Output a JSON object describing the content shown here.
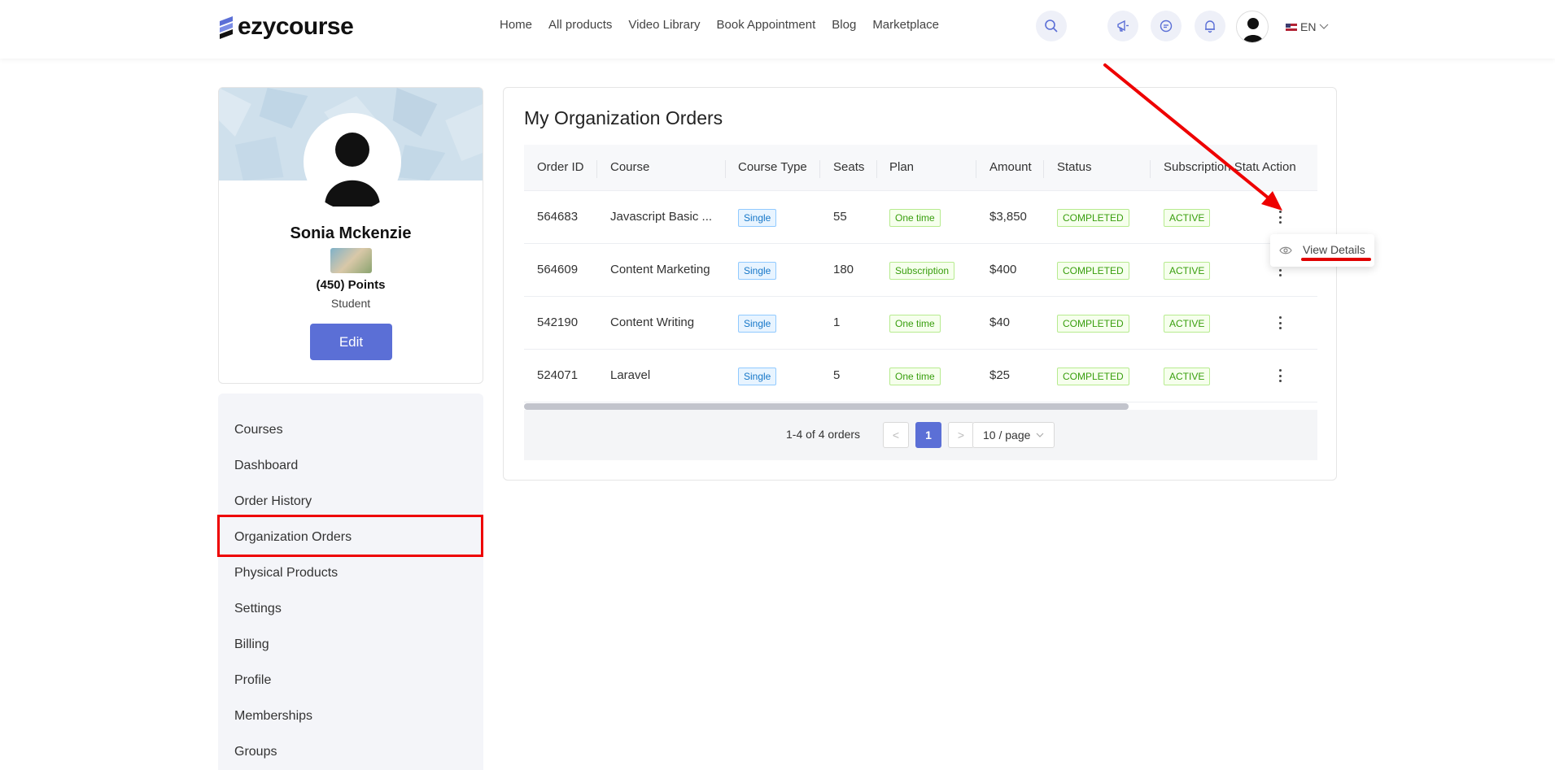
{
  "header": {
    "logo_text": "ezycourse",
    "nav": [
      "Home",
      "All products",
      "Video Library",
      "Book Appointment",
      "Blog",
      "Marketplace"
    ],
    "lang": "EN"
  },
  "profile": {
    "name": "Sonia Mckenzie",
    "points": "(450) Points",
    "role": "Student",
    "edit_label": "Edit"
  },
  "sidebar": {
    "items": [
      "Courses",
      "Dashboard",
      "Order History",
      "Organization Orders",
      "Physical Products",
      "Settings",
      "Billing",
      "Profile",
      "Memberships",
      "Groups"
    ],
    "active": "Organization Orders"
  },
  "main": {
    "title": "My Organization Orders",
    "columns": [
      "Order ID",
      "Course",
      "Course Type",
      "Seats",
      "Plan",
      "Amount",
      "Status",
      "Subscription Status",
      "Action"
    ],
    "rows": [
      {
        "order_id": "564683",
        "course": "Javascript Basic ...",
        "course_type": "Single",
        "seats": "55",
        "plan": "One time",
        "amount": "$3,850",
        "status": "COMPLETED",
        "subscription_status": "ACTIVE"
      },
      {
        "order_id": "564609",
        "course": "Content Marketing",
        "course_type": "Single",
        "seats": "180",
        "plan": "Subscription",
        "amount": "$400",
        "status": "COMPLETED",
        "subscription_status": "ACTIVE"
      },
      {
        "order_id": "542190",
        "course": "Content Writing",
        "course_type": "Single",
        "seats": "1",
        "plan": "One time",
        "amount": "$40",
        "status": "COMPLETED",
        "subscription_status": "ACTIVE"
      },
      {
        "order_id": "524071",
        "course": "Laravel",
        "course_type": "Single",
        "seats": "5",
        "plan": "One time",
        "amount": "$25",
        "status": "COMPLETED",
        "subscription_status": "ACTIVE"
      }
    ],
    "pagination": {
      "summary": "1-4 of 4 orders",
      "prev": "<",
      "current": "1",
      "next": ">",
      "page_size": "10 / page"
    }
  },
  "dropdown": {
    "view_details": "View Details"
  },
  "colors": {
    "accent": "#5b6fd6",
    "annotation": "#ee0000"
  }
}
